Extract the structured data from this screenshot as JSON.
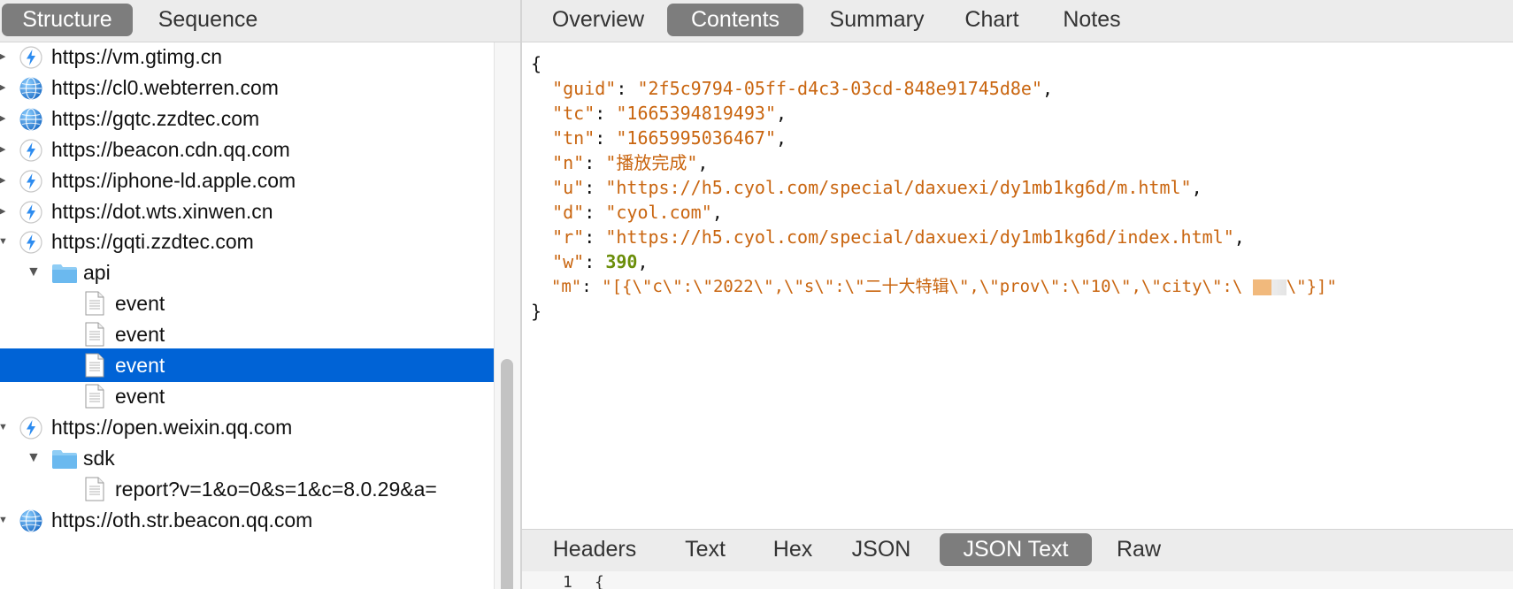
{
  "left_tabs": [
    "Structure",
    "Sequence"
  ],
  "right_tabs": [
    "Overview",
    "Contents",
    "Summary",
    "Chart",
    "Notes"
  ],
  "bottom_tabs": [
    "Headers",
    "Text",
    "Hex",
    "JSON",
    "JSON Text",
    "Raw"
  ],
  "tree": [
    {
      "label": "https://vm.gtimg.cn",
      "icon": "bolt-icon",
      "expanded": false
    },
    {
      "label": "https://cl0.webterren.com",
      "icon": "globe-icon",
      "expanded": false
    },
    {
      "label": "https://gqtc.zzdtec.com",
      "icon": "globe-icon",
      "expanded": false
    },
    {
      "label": "https://beacon.cdn.qq.com",
      "icon": "bolt-icon",
      "expanded": false
    },
    {
      "label": "https://iphone-ld.apple.com",
      "icon": "bolt-icon",
      "expanded": false
    },
    {
      "label": "https://dot.wts.xinwen.cn",
      "icon": "bolt-icon",
      "expanded": false
    },
    {
      "label": "https://gqti.zzdtec.com",
      "icon": "bolt-icon",
      "expanded": true
    },
    {
      "label": "api",
      "icon": "folder-icon",
      "expanded": true
    },
    {
      "label": "event",
      "icon": "document-icon"
    },
    {
      "label": "event",
      "icon": "document-icon"
    },
    {
      "label": "event",
      "icon": "document-icon",
      "selected": true
    },
    {
      "label": "event",
      "icon": "document-icon"
    },
    {
      "label": "https://open.weixin.qq.com",
      "icon": "bolt-icon",
      "expanded": true
    },
    {
      "label": "sdk",
      "icon": "folder-icon",
      "expanded": true
    },
    {
      "label": "report?v=1&o=0&s=1&c=8.0.29&a=",
      "icon": "document-icon"
    },
    {
      "label": "https://oth.str.beacon.qq.com",
      "icon": "globe-icon",
      "expanded": true
    }
  ],
  "json_content": {
    "open_brace": "{",
    "close_brace": "}",
    "guid": "2f5c9794-05ff-d4c3-03cd-848e91745d8e",
    "tc": "1665394819493",
    "tn": "1665995036467",
    "n": "播放完成",
    "u": "https://h5.cyol.com/special/daxuexi/dy1mb1kg6d/m.html",
    "d": "cyol.com",
    "r": "https://h5.cyol.com/special/daxuexi/dy1mb1kg6d/index.html",
    "w": "390",
    "m_start": "[{\\\"c\\\":\\\"2022\\\",\\\"s\\\":\\\"二十大特辑\\\",\\\"prov\\\":\\\"10\\\",\\\"city\\\":\\",
    "m_end": "\\\"}]"
  },
  "raw_line": {
    "number": "1",
    "text": "{"
  },
  "colors": {
    "toolbar": "#ececec",
    "active_segment": "#7d7d7d",
    "selection": "#0063d6",
    "json_string": "#c9650f",
    "json_number": "#6b8e0a"
  }
}
